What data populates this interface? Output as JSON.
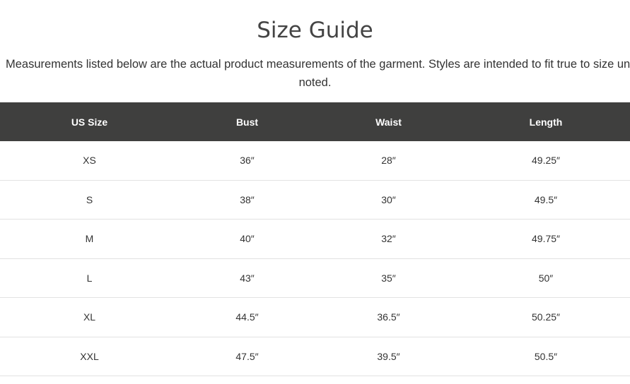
{
  "page": {
    "title": "Size Guide",
    "intro_line1": "Measurements listed below are the actual product measurements of the garment. Styles are intended to fit true to size unless",
    "intro_line2": "noted."
  },
  "table": {
    "headers": [
      "US Size",
      "Bust",
      "Waist",
      "Length"
    ],
    "rows": [
      [
        "XS",
        "36″",
        "28″",
        "49.25″"
      ],
      [
        "S",
        "38″",
        "30″",
        "49.5″"
      ],
      [
        "M",
        "40″",
        "32″",
        "49.75″"
      ],
      [
        "L",
        "43″",
        "35″",
        "50″"
      ],
      [
        "XL",
        "44.5″",
        "36.5″",
        "50.25″"
      ],
      [
        "XXL",
        "47.5″",
        "39.5″",
        "50.5″"
      ]
    ]
  },
  "colors": {
    "header_bg": "#3f3f3e",
    "header_text": "#ffffff",
    "body_text": "#333333",
    "row_divider": "#e2e2e2"
  }
}
